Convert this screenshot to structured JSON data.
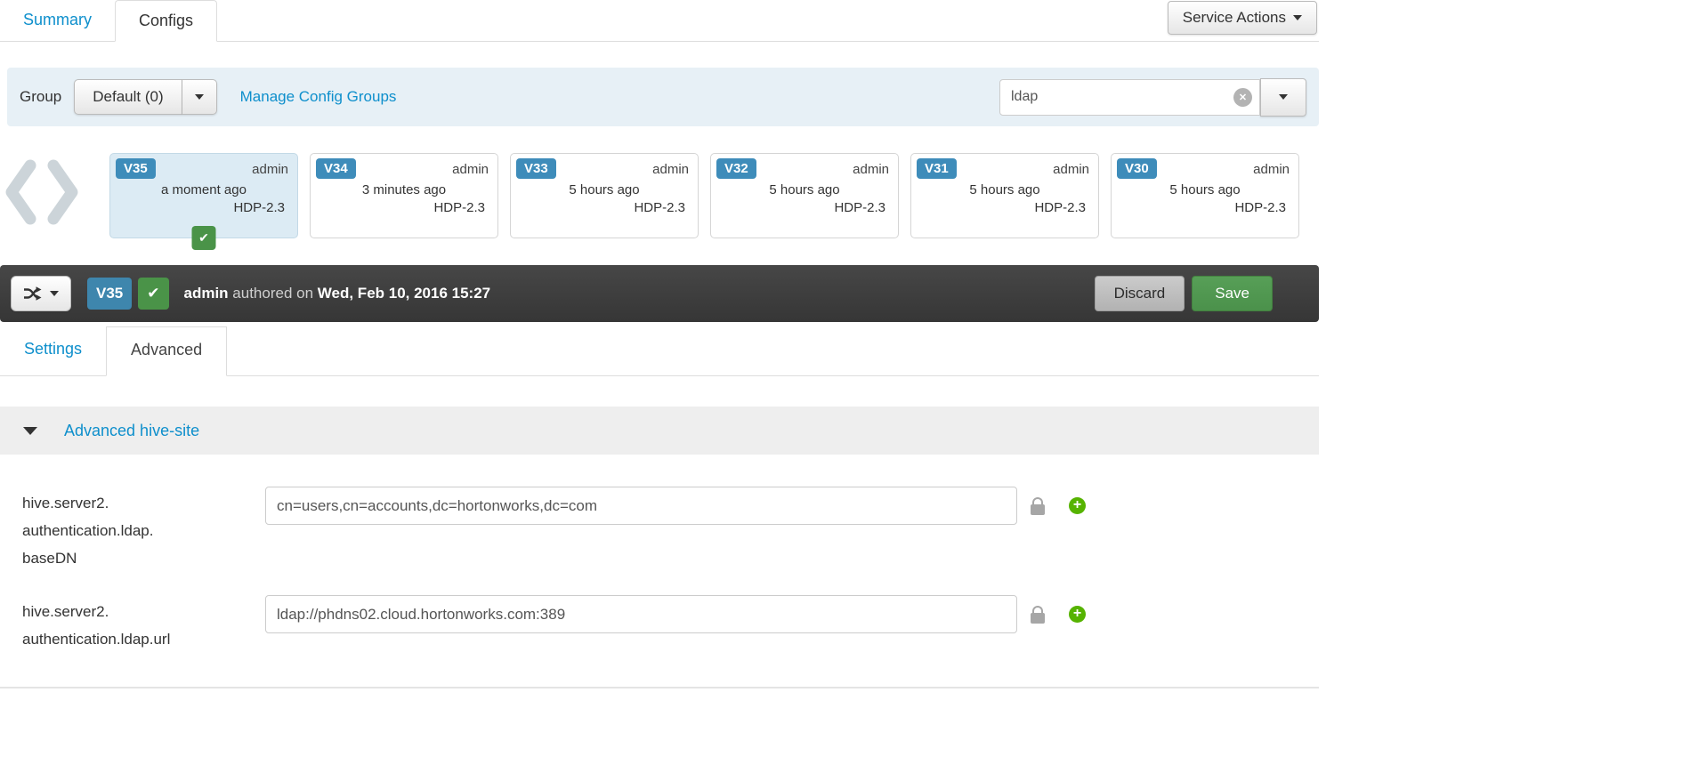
{
  "colors": {
    "accent_blue": "#0e8fcc",
    "version_badge_blue": "#3e8cba",
    "success_green": "#4a9348",
    "add_green": "#56b301",
    "toolbar_dark": "#3d3d3d"
  },
  "top_tabs": {
    "summary": "Summary",
    "configs": "Configs"
  },
  "service_actions": {
    "label": "Service Actions"
  },
  "group_bar": {
    "label": "Group",
    "selected_group": "Default (0)",
    "manage_link": "Manage Config Groups",
    "filter_value": "ldap"
  },
  "versions": [
    {
      "id": "V35",
      "author": "admin",
      "time": "a moment ago",
      "stack": "HDP-2.3"
    },
    {
      "id": "V34",
      "author": "admin",
      "time": "3 minutes ago",
      "stack": "HDP-2.3"
    },
    {
      "id": "V33",
      "author": "admin",
      "time": "5 hours ago",
      "stack": "HDP-2.3"
    },
    {
      "id": "V32",
      "author": "admin",
      "time": "5 hours ago",
      "stack": "HDP-2.3"
    },
    {
      "id": "V31",
      "author": "admin",
      "time": "5 hours ago",
      "stack": "HDP-2.3"
    },
    {
      "id": "V30",
      "author": "admin",
      "time": "5 hours ago",
      "stack": "HDP-2.3"
    }
  ],
  "version_toolbar": {
    "version": "V35",
    "author": "admin",
    "authored_text": "authored on",
    "date": "Wed, Feb 10, 2016 15:27",
    "discard_label": "Discard",
    "save_label": "Save"
  },
  "config_tabs": {
    "settings": "Settings",
    "advanced": "Advanced"
  },
  "section": {
    "title": "Advanced hive-site"
  },
  "configs": [
    {
      "label_lines": [
        "hive.server2.",
        "authentication.ldap.",
        "baseDN"
      ],
      "value": "cn=users,cn=accounts,dc=hortonworks,dc=com"
    },
    {
      "label_lines": [
        "hive.server2.",
        "authentication.ldap.url",
        ""
      ],
      "value": "ldap://phdns02.cloud.hortonworks.com:389"
    }
  ]
}
